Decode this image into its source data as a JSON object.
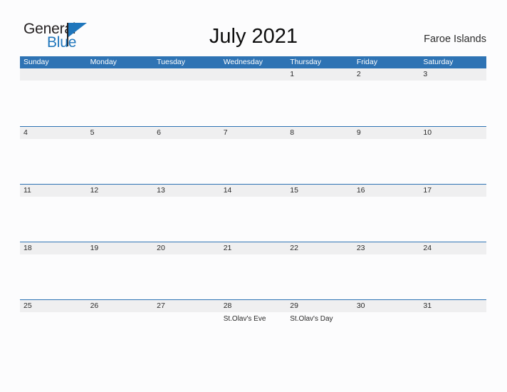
{
  "branding": {
    "logo_text_primary": "General",
    "logo_text_secondary": "Blue",
    "logo_icon": "blue-triangle-flag-icon",
    "primary_color": "#1f76bc"
  },
  "header": {
    "title": "July 2021",
    "region": "Faroe Islands"
  },
  "theme": {
    "header_blue": "#2e73b4",
    "row_strip_gray": "#efeff0",
    "page_background": "#fcfcfd",
    "text_dark": "#2a2a2a"
  },
  "calendar": {
    "month": "July",
    "year": "2021",
    "weekday_headers": [
      "Sunday",
      "Monday",
      "Tuesday",
      "Wednesday",
      "Thursday",
      "Friday",
      "Saturday"
    ],
    "weeks": [
      {
        "days": [
          {
            "date": "",
            "events": []
          },
          {
            "date": "",
            "events": []
          },
          {
            "date": "",
            "events": []
          },
          {
            "date": "",
            "events": []
          },
          {
            "date": "1",
            "events": []
          },
          {
            "date": "2",
            "events": []
          },
          {
            "date": "3",
            "events": []
          }
        ]
      },
      {
        "days": [
          {
            "date": "4",
            "events": []
          },
          {
            "date": "5",
            "events": []
          },
          {
            "date": "6",
            "events": []
          },
          {
            "date": "7",
            "events": []
          },
          {
            "date": "8",
            "events": []
          },
          {
            "date": "9",
            "events": []
          },
          {
            "date": "10",
            "events": []
          }
        ]
      },
      {
        "days": [
          {
            "date": "11",
            "events": []
          },
          {
            "date": "12",
            "events": []
          },
          {
            "date": "13",
            "events": []
          },
          {
            "date": "14",
            "events": []
          },
          {
            "date": "15",
            "events": []
          },
          {
            "date": "16",
            "events": []
          },
          {
            "date": "17",
            "events": []
          }
        ]
      },
      {
        "days": [
          {
            "date": "18",
            "events": []
          },
          {
            "date": "19",
            "events": []
          },
          {
            "date": "20",
            "events": []
          },
          {
            "date": "21",
            "events": []
          },
          {
            "date": "22",
            "events": []
          },
          {
            "date": "23",
            "events": []
          },
          {
            "date": "24",
            "events": []
          }
        ]
      },
      {
        "days": [
          {
            "date": "25",
            "events": []
          },
          {
            "date": "26",
            "events": []
          },
          {
            "date": "27",
            "events": []
          },
          {
            "date": "28",
            "events": [
              "St.Olav's Eve"
            ]
          },
          {
            "date": "29",
            "events": [
              "St.Olav's Day"
            ]
          },
          {
            "date": "30",
            "events": []
          },
          {
            "date": "31",
            "events": []
          }
        ]
      }
    ]
  }
}
